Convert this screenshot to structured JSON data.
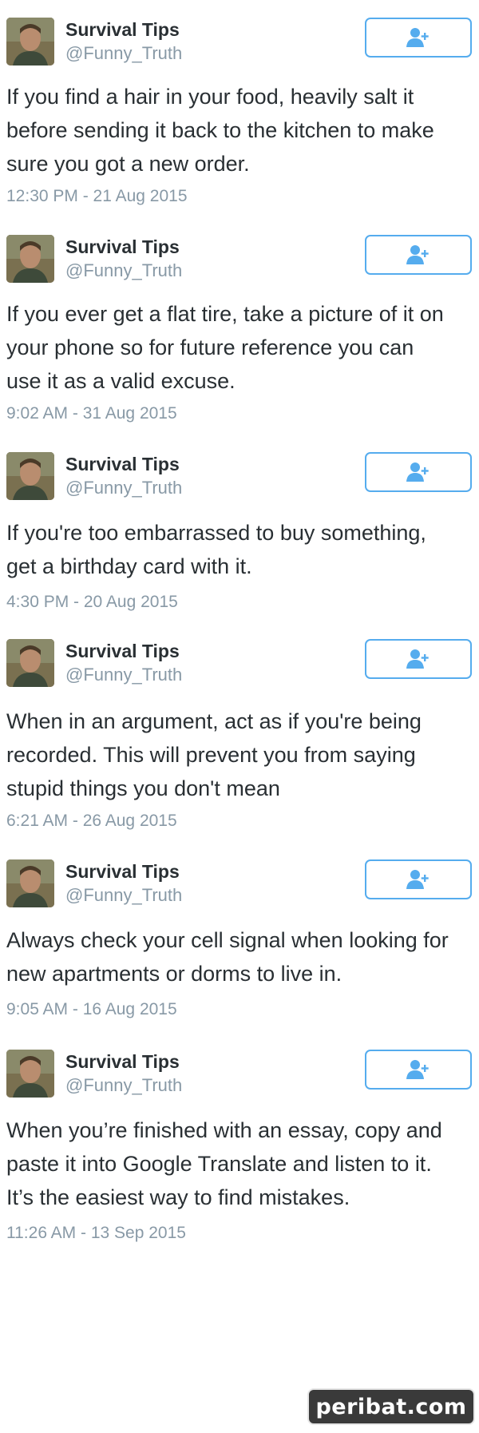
{
  "colors": {
    "accent": "#55acee",
    "text": "#292f33",
    "secondary": "#8899a6"
  },
  "icons": {
    "follow": "follow-user-plus-icon",
    "avatar": "profile-photo"
  },
  "watermark": "peribat.com",
  "tweets": [
    {
      "name": "Survival Tips",
      "handle": "@Funny_Truth",
      "text": "If you find a hair in your food, heavily salt it\nbefore sending it back to the kitchen to make\nsure you got a new order.",
      "timestamp": "12:30 PM - 21 Aug 2015"
    },
    {
      "name": "Survival Tips",
      "handle": "@Funny_Truth",
      "text": "If you ever get a flat tire, take a picture of it on\nyour phone so for future reference you can\nuse it as a valid excuse.",
      "timestamp": "9:02 AM - 31 Aug 2015"
    },
    {
      "name": "Survival Tips",
      "handle": "@Funny_Truth",
      "text": "If you're too embarrassed to buy something,\nget a birthday card with it.",
      "timestamp": "4:30 PM - 20 Aug 2015"
    },
    {
      "name": "Survival Tips",
      "handle": "@Funny_Truth",
      "text": "When in an argument, act as if you're being\nrecorded. This will prevent you from saying\nstupid things you don't mean",
      "timestamp": "6:21 AM - 26 Aug 2015"
    },
    {
      "name": "Survival Tips",
      "handle": "@Funny_Truth",
      "text": "Always check your cell signal when looking for\nnew apartments or dorms to live in.",
      "timestamp": "9:05 AM - 16 Aug 2015"
    },
    {
      "name": "Survival Tips",
      "handle": "@Funny_Truth",
      "text": "When you’re finished with an essay, copy and\npaste it into Google Translate and listen to it.\nIt’s the easiest way to find mistakes.",
      "timestamp": "11:26 AM - 13 Sep 2015"
    }
  ]
}
